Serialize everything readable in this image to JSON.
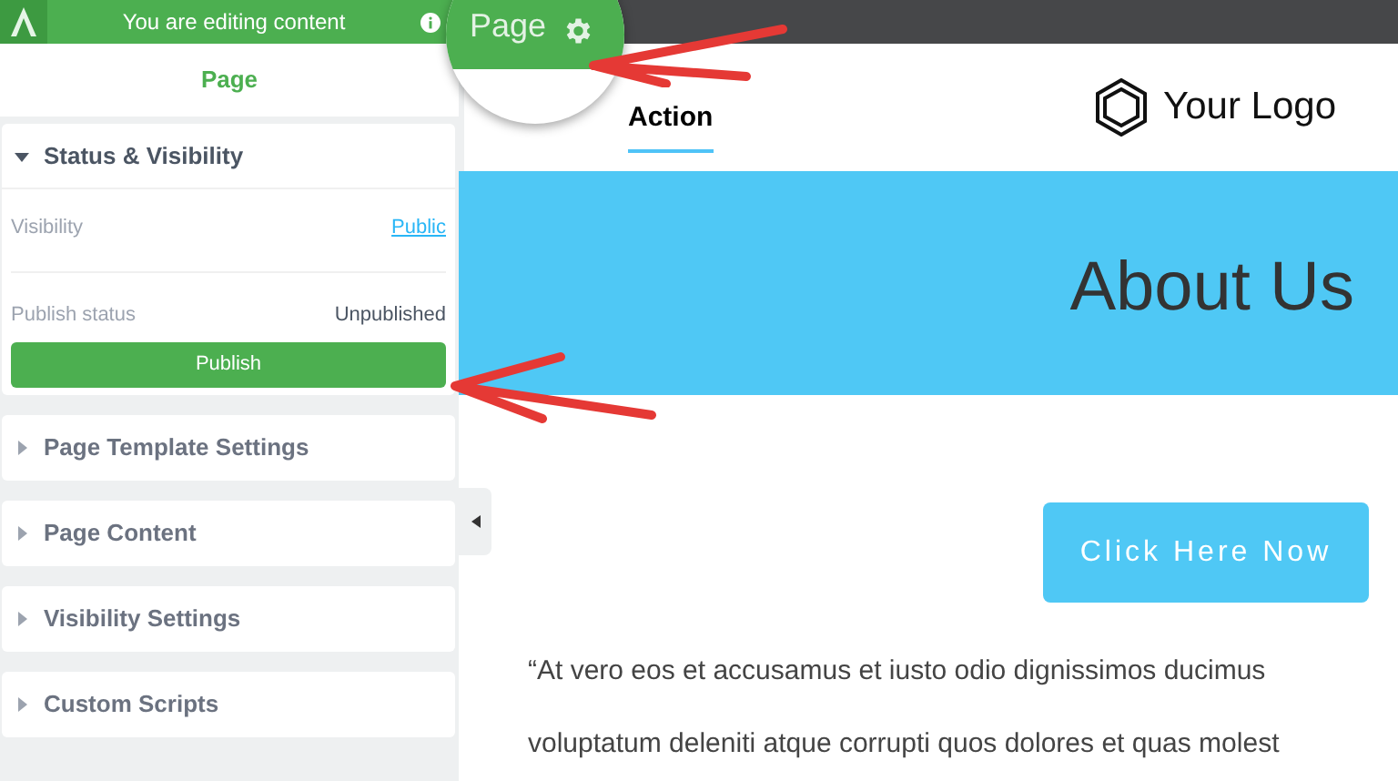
{
  "editor_bar": {
    "message": "You are editing content"
  },
  "sidebar": {
    "title": "Page",
    "sections": [
      {
        "title": "Status & Visibility",
        "expanded": true,
        "fields": [
          {
            "label": "Visibility",
            "value": "Public",
            "kind": "link"
          },
          {
            "label": "Publish status",
            "value": "Unpublished",
            "kind": "text"
          }
        ],
        "button": "Publish"
      },
      {
        "title": "Page Template Settings",
        "expanded": false
      },
      {
        "title": "Page Content",
        "expanded": false
      },
      {
        "title": "Visibility Settings",
        "expanded": false
      },
      {
        "title": "Custom Scripts",
        "expanded": false
      }
    ]
  },
  "magnifier": {
    "label": "Page"
  },
  "preview": {
    "nav_link": "Action",
    "logo": "Your Logo",
    "banner_title": "About Us",
    "cta_button": "Click Here Now",
    "paragraph_lines": [
      "“At vero eos et accusamus et iusto odio dignissimos ducimus",
      "voluptatum deleniti atque corrupti quos dolores et quas molest"
    ]
  }
}
